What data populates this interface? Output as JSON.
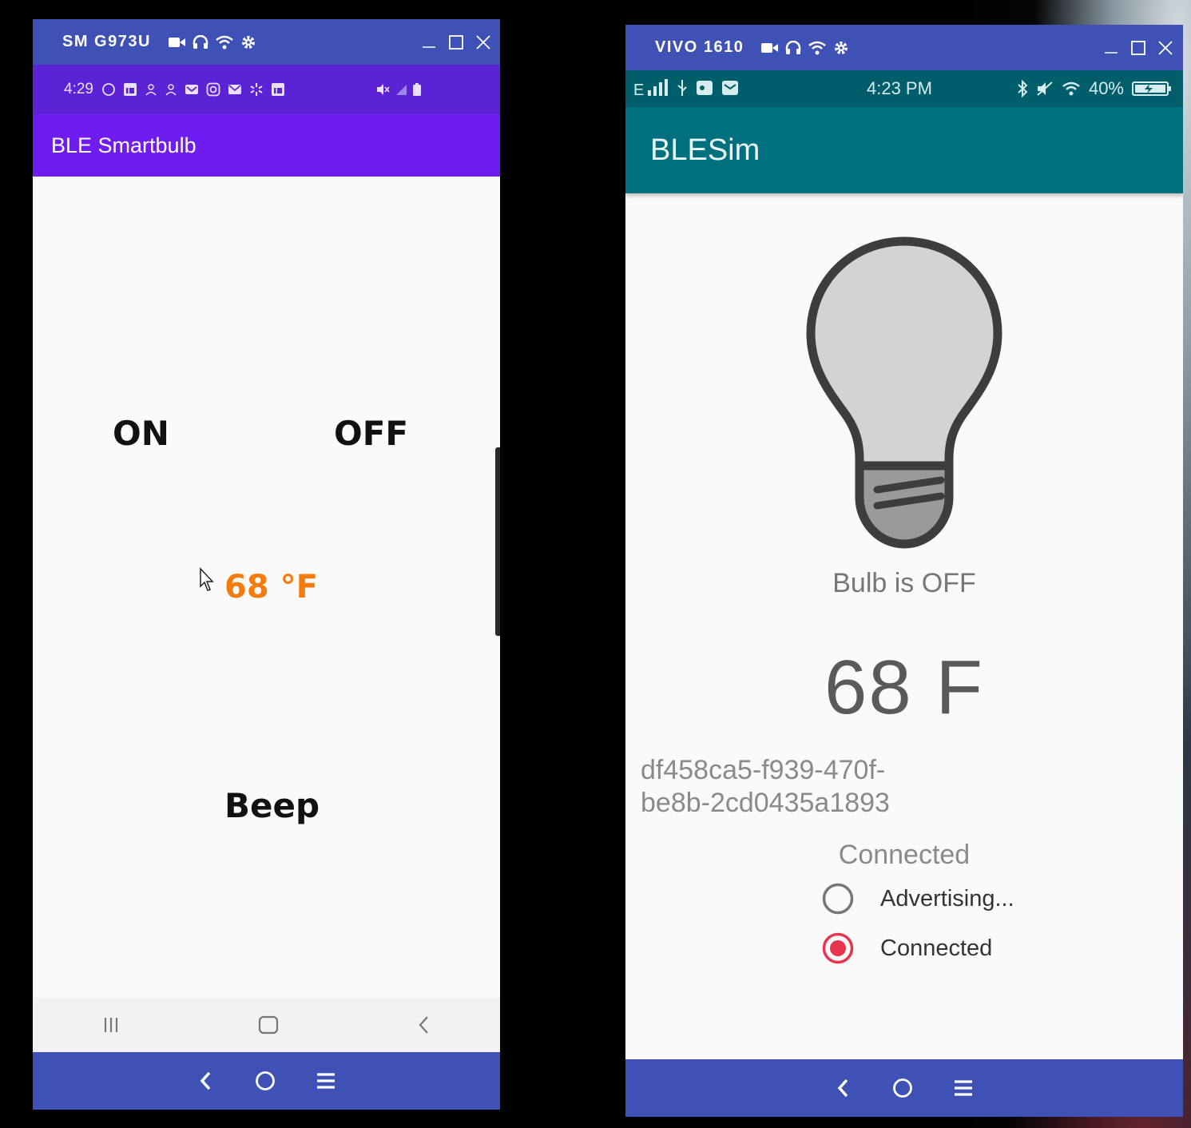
{
  "left_window": {
    "title": "SM G973U",
    "status_bar": {
      "time": "4:29"
    },
    "app_title": "BLE Smartbulb",
    "on_label": "ON",
    "off_label": "OFF",
    "temperature": "68 °F",
    "beep_label": "Beep",
    "icons": [
      "video-icon",
      "headphones-icon",
      "wifi-icon",
      "settings-icon",
      "minimize-icon",
      "maximize-icon",
      "close-icon"
    ]
  },
  "right_window": {
    "title": "VIVO 1610",
    "status_bar": {
      "time": "4:23 PM",
      "battery": "40%"
    },
    "app_title": "BLESim",
    "bulb_status": "Bulb is OFF",
    "temperature": "68 F",
    "uuid_line1": "df458ca5-f939-470f-",
    "uuid_line2": "be8b-2cd0435a1893",
    "connection_status": "Connected",
    "radio_options": [
      {
        "label": "Advertising...",
        "selected": false
      },
      {
        "label": "Connected",
        "selected": true
      }
    ]
  },
  "colors": {
    "window_bar": "#3f51b5",
    "left_status": "#5b22d6",
    "left_appbar": "#6f1cf2",
    "temp_orange": "#f47c0e",
    "right_status": "#005e6b",
    "right_appbar": "#00707e",
    "radio_accent": "#e8344e"
  }
}
